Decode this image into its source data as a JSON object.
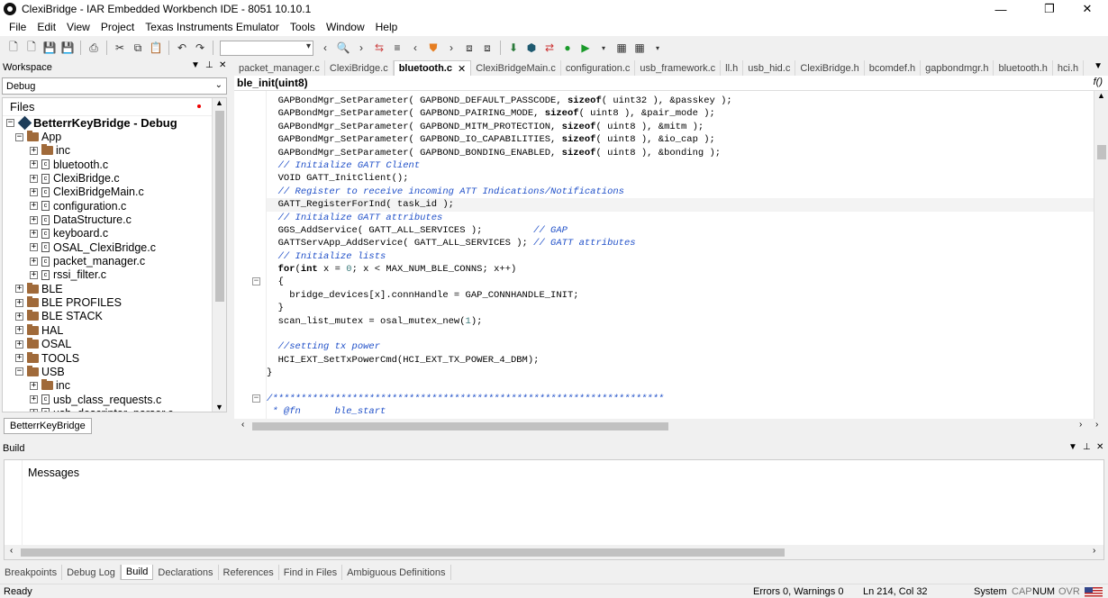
{
  "titlebar": {
    "title": "ClexiBridge - IAR Embedded Workbench IDE - 8051 10.10.1",
    "minimize_icon": "minimize-icon",
    "maximize_icon": "maximize-icon",
    "close_icon": "close-icon"
  },
  "menu": [
    "File",
    "Edit",
    "View",
    "Project",
    "Texas Instruments Emulator",
    "Tools",
    "Window",
    "Help"
  ],
  "workspace": {
    "title": "Workspace",
    "configuration": "Debug",
    "files_header": "Files",
    "project_name": "BetterrKeyBridge - Debug",
    "bottom_tab": "BetterrKeyBridge",
    "tree": [
      {
        "label": "App",
        "type": "folder",
        "depth": 1,
        "expander": "−"
      },
      {
        "label": "inc",
        "type": "folder",
        "depth": 2,
        "expander": "+"
      },
      {
        "label": "bluetooth.c",
        "type": "file",
        "depth": 2,
        "expander": "+"
      },
      {
        "label": "ClexiBridge.c",
        "type": "file",
        "depth": 2,
        "expander": "+"
      },
      {
        "label": "ClexiBridgeMain.c",
        "type": "file",
        "depth": 2,
        "expander": "+"
      },
      {
        "label": "configuration.c",
        "type": "file",
        "depth": 2,
        "expander": "+"
      },
      {
        "label": "DataStructure.c",
        "type": "file",
        "depth": 2,
        "expander": "+"
      },
      {
        "label": "keyboard.c",
        "type": "file",
        "depth": 2,
        "expander": "+"
      },
      {
        "label": "OSAL_ClexiBridge.c",
        "type": "file",
        "depth": 2,
        "expander": "+"
      },
      {
        "label": "packet_manager.c",
        "type": "file",
        "depth": 2,
        "expander": "+"
      },
      {
        "label": "rssi_filter.c",
        "type": "file",
        "depth": 2,
        "expander": "+"
      },
      {
        "label": "BLE",
        "type": "folder",
        "depth": 1,
        "expander": "+"
      },
      {
        "label": "BLE PROFILES",
        "type": "folder",
        "depth": 1,
        "expander": "+"
      },
      {
        "label": "BLE STACK",
        "type": "folder",
        "depth": 1,
        "expander": "+"
      },
      {
        "label": "HAL",
        "type": "folder",
        "depth": 1,
        "expander": "+"
      },
      {
        "label": "OSAL",
        "type": "folder",
        "depth": 1,
        "expander": "+"
      },
      {
        "label": "TOOLS",
        "type": "folder",
        "depth": 1,
        "expander": "+"
      },
      {
        "label": "USB",
        "type": "folder",
        "depth": 1,
        "expander": "−"
      },
      {
        "label": "inc",
        "type": "folder",
        "depth": 2,
        "expander": "+"
      },
      {
        "label": "usb_class_requests.c",
        "type": "file",
        "depth": 2,
        "expander": "+"
      },
      {
        "label": "usb_descriptor_parser.c",
        "type": "file",
        "depth": 2,
        "expander": "+"
      }
    ]
  },
  "editor": {
    "tabs": [
      {
        "label": "packet_manager.c",
        "active": false
      },
      {
        "label": "ClexiBridge.c",
        "active": false
      },
      {
        "label": "bluetooth.c",
        "active": true
      },
      {
        "label": "ClexiBridgeMain.c",
        "active": false
      },
      {
        "label": "configuration.c",
        "active": false
      },
      {
        "label": "usb_framework.c",
        "active": false
      },
      {
        "label": "ll.h",
        "active": false
      },
      {
        "label": "usb_hid.c",
        "active": false
      },
      {
        "label": "ClexiBridge.h",
        "active": false
      },
      {
        "label": "bcomdef.h",
        "active": false
      },
      {
        "label": "gapbondmgr.h",
        "active": false
      },
      {
        "label": "bluetooth.h",
        "active": false
      },
      {
        "label": "hci.h",
        "active": false
      }
    ],
    "function_context": "ble_init(uint8)",
    "fx_label": "f()",
    "lines": [
      "  GAPBondMgr_SetParameter( GAPBOND_DEFAULT_PASSCODE, sizeof( uint32 ), &passkey );",
      "  GAPBondMgr_SetParameter( GAPBOND_PAIRING_MODE, sizeof( uint8 ), &pair_mode );",
      "  GAPBondMgr_SetParameter( GAPBOND_MITM_PROTECTION, sizeof( uint8 ), &mitm );",
      "  GAPBondMgr_SetParameter( GAPBOND_IO_CAPABILITIES, sizeof( uint8 ), &io_cap );",
      "  GAPBondMgr_SetParameter( GAPBOND_BONDING_ENABLED, sizeof( uint8 ), &bonding );",
      "  // Initialize GATT Client",
      "  VOID GATT_InitClient();",
      "  // Register to receive incoming ATT Indications/Notifications",
      "  GATT_RegisterForInd( task_id );",
      "  // Initialize GATT attributes",
      "  GGS_AddService( GATT_ALL_SERVICES );         // GAP",
      "  GATTServApp_AddService( GATT_ALL_SERVICES ); // GATT attributes",
      "  // Initialize lists",
      "  for(int x = 0; x < MAX_NUM_BLE_CONNS; x++)",
      "  {",
      "    bridge_devices[x].connHandle = GAP_CONNHANDLE_INIT;",
      "  }",
      "  scan_list_mutex = osal_mutex_new(1);",
      "",
      "  //setting tx power",
      "  HCI_EXT_SetTxPowerCmd(HCI_EXT_TX_POWER_4_DBM);",
      "}",
      "",
      "/*********************************************************************",
      " * @fn      ble_start"
    ]
  },
  "build": {
    "title": "Build",
    "messages_header": "Messages"
  },
  "bottom_tabs": [
    {
      "label": "Breakpoints",
      "active": false
    },
    {
      "label": "Debug Log",
      "active": false
    },
    {
      "label": "Build",
      "active": true
    },
    {
      "label": "Declarations",
      "active": false
    },
    {
      "label": "References",
      "active": false
    },
    {
      "label": "Find in Files",
      "active": false
    },
    {
      "label": "Ambiguous Definitions",
      "active": false
    }
  ],
  "status": {
    "left": "Ready",
    "errors": "Errors 0, Warnings 0",
    "position": "Ln 214, Col 32",
    "encoding": "System",
    "cap": "CAP",
    "num": "NUM",
    "ovr": "OVR"
  }
}
